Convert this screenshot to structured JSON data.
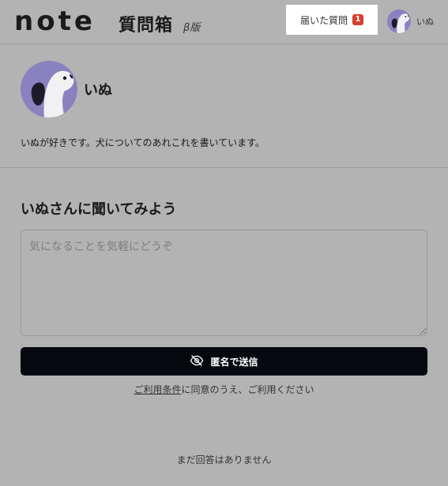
{
  "header": {
    "logo_text": "note",
    "product_name": "質問箱",
    "beta_label": "β版",
    "received_button": {
      "label": "届いた質問",
      "badge_count": "1"
    },
    "user": {
      "name": "いぬ",
      "avatar_icon": "dog-avatar-icon"
    }
  },
  "profile": {
    "avatar_icon": "dog-avatar-icon",
    "name": "いぬ",
    "bio": "いぬが好きです。犬についてのあれこれを書いています。"
  },
  "ask": {
    "heading": "いぬさんに聞いてみよう",
    "placeholder": "気になることを気軽にどうぞ",
    "send_label": "匿名で送信",
    "send_icon": "eye-slash-icon",
    "terms_link": "ご利用条件",
    "terms_suffix": "に同意のうえ、ご利用ください"
  },
  "answers": {
    "empty_text": "まだ回答はありません"
  },
  "colors": {
    "background": "#b3b3b3",
    "primary_button": "#060a10",
    "badge": "#d6402c",
    "avatar_bg": "#8a82c0"
  }
}
